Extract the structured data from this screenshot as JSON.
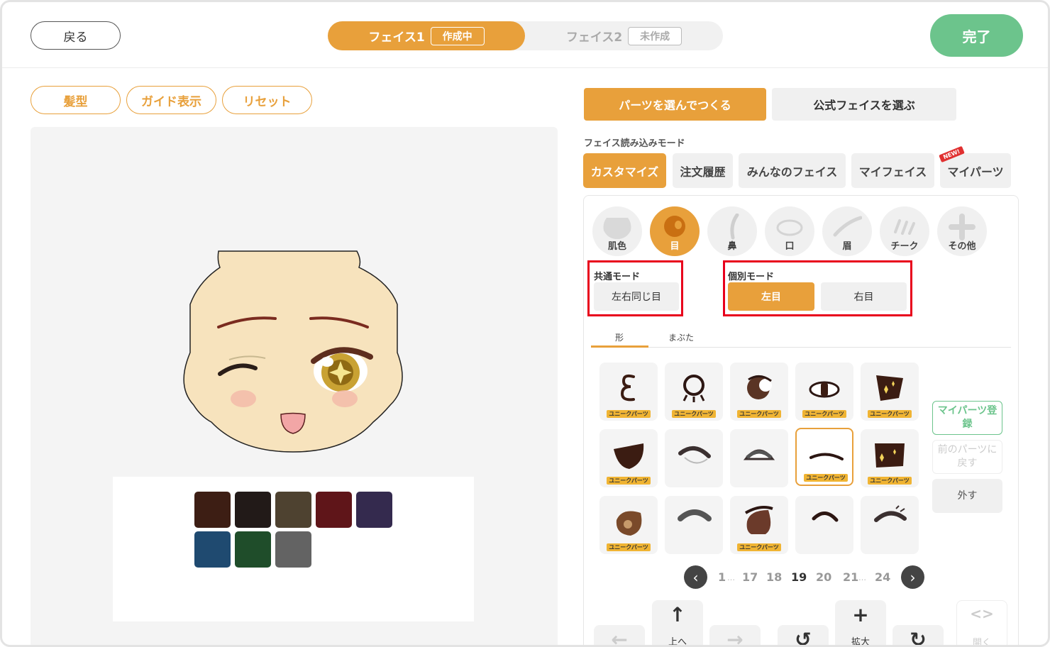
{
  "header": {
    "back_label": "戻る",
    "face_tabs": [
      {
        "label": "フェイス1",
        "status": "作成中"
      },
      {
        "label": "フェイス2",
        "status": "未作成"
      }
    ],
    "done_label": "完了"
  },
  "left_toolbar": {
    "hair_label": "髪型",
    "guide_label": "ガイド表示",
    "reset_label": "リセット"
  },
  "palette": {
    "colors": [
      "#3d1e14",
      "#221a18",
      "#4e4230",
      "#5f1519",
      "#342a4e",
      "#1f4a70",
      "#1f4d2a",
      "#636363"
    ]
  },
  "right": {
    "mode_buttons": [
      "パーツを選んでつくる",
      "公式フェイスを選ぶ"
    ],
    "load_mode_label": "フェイス読み込みモード",
    "load_tabs": [
      "カスタマイズ",
      "注文履歴",
      "みんなのフェイス",
      "マイフェイス",
      "マイパーツ"
    ],
    "new_badge": "NEW!",
    "categories": [
      "肌色",
      "目",
      "鼻",
      "口",
      "眉",
      "チーク",
      "その他"
    ],
    "common_mode": {
      "title": "共通モード",
      "button": "左右同じ目"
    },
    "individual_mode": {
      "title": "個別モード",
      "left": "左目",
      "right": "右目"
    },
    "subtabs": [
      "形",
      "まぶた"
    ],
    "unique_badge": "ユニークパーツ",
    "side_buttons": {
      "register": "マイパーツ登録",
      "undo": "前のパーツに戻す",
      "remove": "外す"
    },
    "pagination": {
      "pages": [
        "1",
        "17",
        "18",
        "19",
        "20",
        "21",
        "24"
      ],
      "current": "19",
      "ellipsis": "…"
    },
    "controls": {
      "up": "上へ",
      "enlarge": "拡大",
      "open": "開く"
    }
  }
}
